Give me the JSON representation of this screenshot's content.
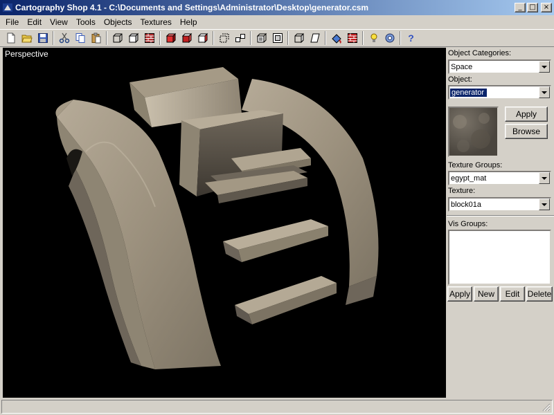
{
  "window": {
    "title": "Cartography Shop 4.1 - C:\\Documents and Settings\\Administrator\\Desktop\\generator.csm",
    "minimize_glyph": "_",
    "maximize_glyph": "□",
    "close_glyph": "×"
  },
  "menu": {
    "file": "File",
    "edit": "Edit",
    "view": "View",
    "tools": "Tools",
    "objects": "Objects",
    "textures": "Textures",
    "help": "Help"
  },
  "toolbar": {
    "help_glyph": "?"
  },
  "viewport": {
    "label": "Perspective"
  },
  "panel": {
    "object_categories_label": "Object Categories:",
    "object_categories_value": "Space",
    "object_label": "Object:",
    "object_value": "generator",
    "apply_label": "Apply",
    "browse_label": "Browse",
    "texture_groups_label": "Texture Groups:",
    "texture_groups_value": "egypt_mat",
    "texture_label": "Texture:",
    "texture_value": "block01a",
    "vis_groups_label": "Vis Groups:",
    "vis_apply_label": "Apply",
    "vis_new_label": "New",
    "vis_edit_label": "Edit",
    "vis_delete_label": "Delete"
  }
}
